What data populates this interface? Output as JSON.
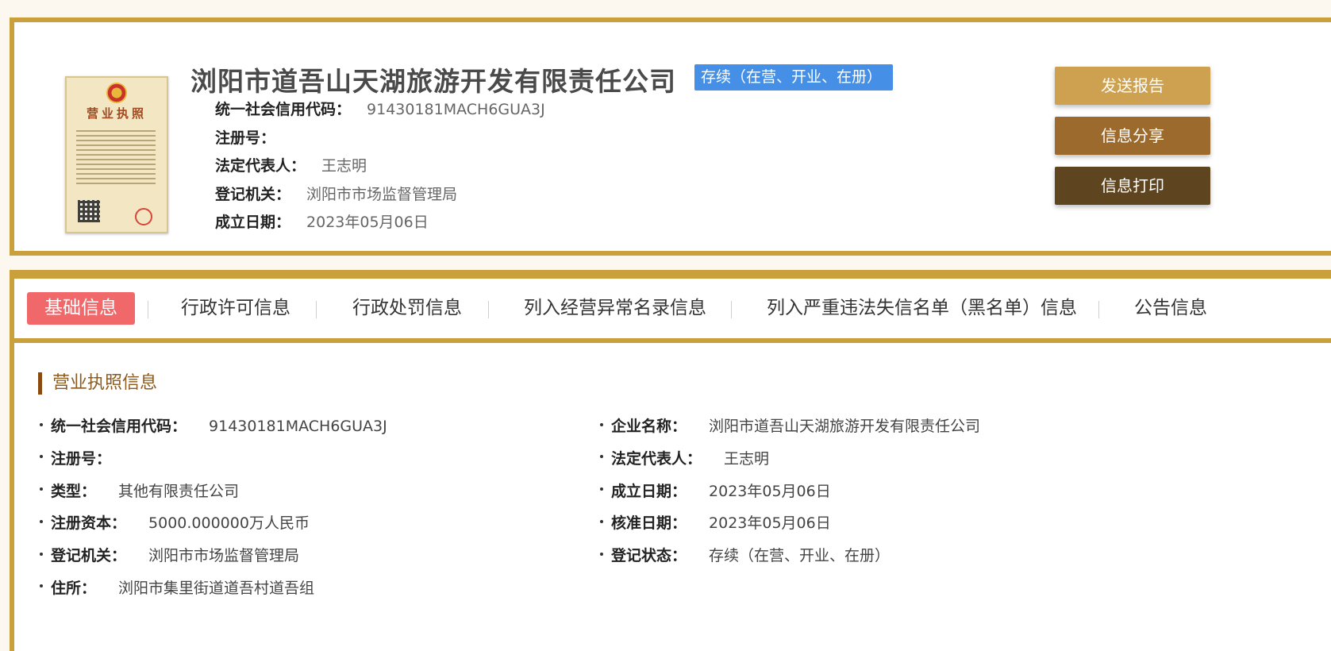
{
  "header": {
    "company_name": "浏阳市道吾山天湖旅游开发有限责任公司",
    "status_badge": "存续（在营、开业、在册）",
    "license_title": "营业执照",
    "rows": [
      {
        "label": "统一社会信用代码：",
        "value": "91430181MACH6GUA3J"
      },
      {
        "label": "注册号：",
        "value": ""
      },
      {
        "label": "法定代表人：",
        "value": "王志明"
      },
      {
        "label": "登记机关：",
        "value": "浏阳市市场监督管理局"
      },
      {
        "label": "成立日期：",
        "value": "2023年05月06日"
      }
    ],
    "buttons": {
      "report": "发送报告",
      "share": "信息分享",
      "print": "信息打印"
    }
  },
  "tabs": [
    {
      "label": "基础信息",
      "active": true
    },
    {
      "label": "行政许可信息"
    },
    {
      "label": "行政处罚信息"
    },
    {
      "label": "列入经营异常名录信息"
    },
    {
      "label": "列入严重违法失信名单（黑名单）信息"
    },
    {
      "label": "公告信息"
    }
  ],
  "section": {
    "title": "营业执照信息",
    "left": [
      {
        "label": "统一社会信用代码：",
        "value": "91430181MACH6GUA3J"
      },
      {
        "label": "注册号：",
        "value": ""
      },
      {
        "label": "类型：",
        "value": "其他有限责任公司"
      },
      {
        "label": "注册资本：",
        "value": "5000.000000万人民币"
      },
      {
        "label": "登记机关：",
        "value": "浏阳市市场监督管理局"
      },
      {
        "label": "住所：",
        "value": "浏阳市集里街道道吾村道吾组"
      }
    ],
    "right": [
      {
        "label": "企业名称：",
        "value": "浏阳市道吾山天湖旅游开发有限责任公司"
      },
      {
        "label": "法定代表人：",
        "value": "王志明"
      },
      {
        "label": "成立日期：",
        "value": "2023年05月06日"
      },
      {
        "label": "核准日期：",
        "value": "2023年05月06日"
      },
      {
        "label": "登记状态：",
        "value": "存续（在营、开业、在册）"
      }
    ]
  },
  "colors": {
    "gold_border": "#c9a03c",
    "badge_blue": "#4590e6",
    "active_tab": "#f0686a",
    "btn_report": "#cda150",
    "btn_share": "#9b6a2c",
    "btn_print": "#5e4520"
  }
}
